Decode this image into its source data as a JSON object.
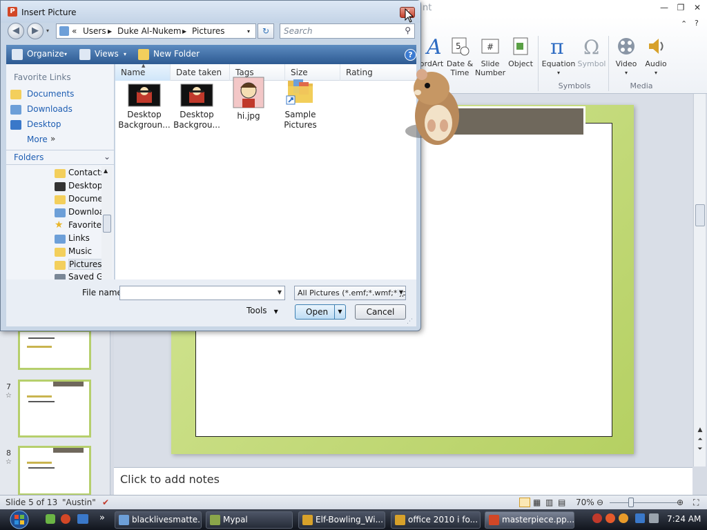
{
  "powerpoint": {
    "title_fragment": "nt",
    "window_buttons": [
      "—",
      "❐",
      "✕"
    ],
    "help_button": "?",
    "ribbon_items": [
      {
        "label": "ordArt",
        "name": "wordart"
      },
      {
        "label": "Date & Time",
        "name": "date-time"
      },
      {
        "label": "Slide Number",
        "name": "slide-number"
      },
      {
        "label": "Object",
        "name": "object"
      },
      {
        "label": "Equation",
        "name": "equation"
      },
      {
        "label": "Symbol",
        "name": "symbol"
      },
      {
        "label": "Video",
        "name": "video"
      },
      {
        "label": "Audio",
        "name": "audio"
      }
    ],
    "ribbon_group_symbols": "Symbols",
    "ribbon_group_media": "Media",
    "notes_placeholder": "Click to add notes",
    "thumbnails": [
      {
        "num": "7"
      },
      {
        "num": "8"
      }
    ],
    "status": {
      "slide": "Slide 5 of 13",
      "theme": "\"Austin\"",
      "zoom": "70%"
    }
  },
  "dialog": {
    "title": "Insert Picture",
    "close_label": "✕",
    "breadcrumb": [
      "«",
      "Users",
      "Duke Al-Nukem",
      "Pictures"
    ],
    "search_placeholder": "Search",
    "toolbar": {
      "organize": "Organize",
      "views": "Views",
      "new_folder": "New Folder"
    },
    "favorite_links_header": "Favorite Links",
    "favorite_links": [
      "Documents",
      "Downloads",
      "Desktop"
    ],
    "more_label": "More",
    "folders_header": "Folders",
    "tree_items": [
      "Contacts",
      "Desktop",
      "Documents",
      "Downloads",
      "Favorites",
      "Links",
      "Music",
      "Pictures",
      "Saved Games"
    ],
    "selected_tree_item": "Pictures",
    "columns": [
      "Name",
      "Date taken",
      "Tags",
      "Size",
      "Rating"
    ],
    "files": [
      {
        "label": "Desktop Backgroun...",
        "kind": "image"
      },
      {
        "label": "Desktop Backgrou...",
        "kind": "image"
      },
      {
        "label": "hi.jpg",
        "kind": "image"
      },
      {
        "label": "Sample Pictures",
        "kind": "folder-shortcut"
      }
    ],
    "file_name_label": "File name:",
    "file_name_value": "",
    "filter_value": "All Pictures (*.emf;*.wmf;*.jpg;",
    "tools_label": "Tools",
    "open_label": "Open",
    "cancel_label": "Cancel"
  },
  "taskbar": {
    "buttons": [
      "blacklivesmatte...",
      "Mypal",
      "Elf-Bowling_Wi...",
      "office 2010 i fo...",
      "masterpiece.pp..."
    ],
    "active_index": 4,
    "time": "7:24 AM",
    "overflow_label": "»"
  },
  "colors": {
    "accent": "#2d5a92",
    "slide_green": "#b5d062",
    "title_bar_brown": "#6f685c"
  }
}
